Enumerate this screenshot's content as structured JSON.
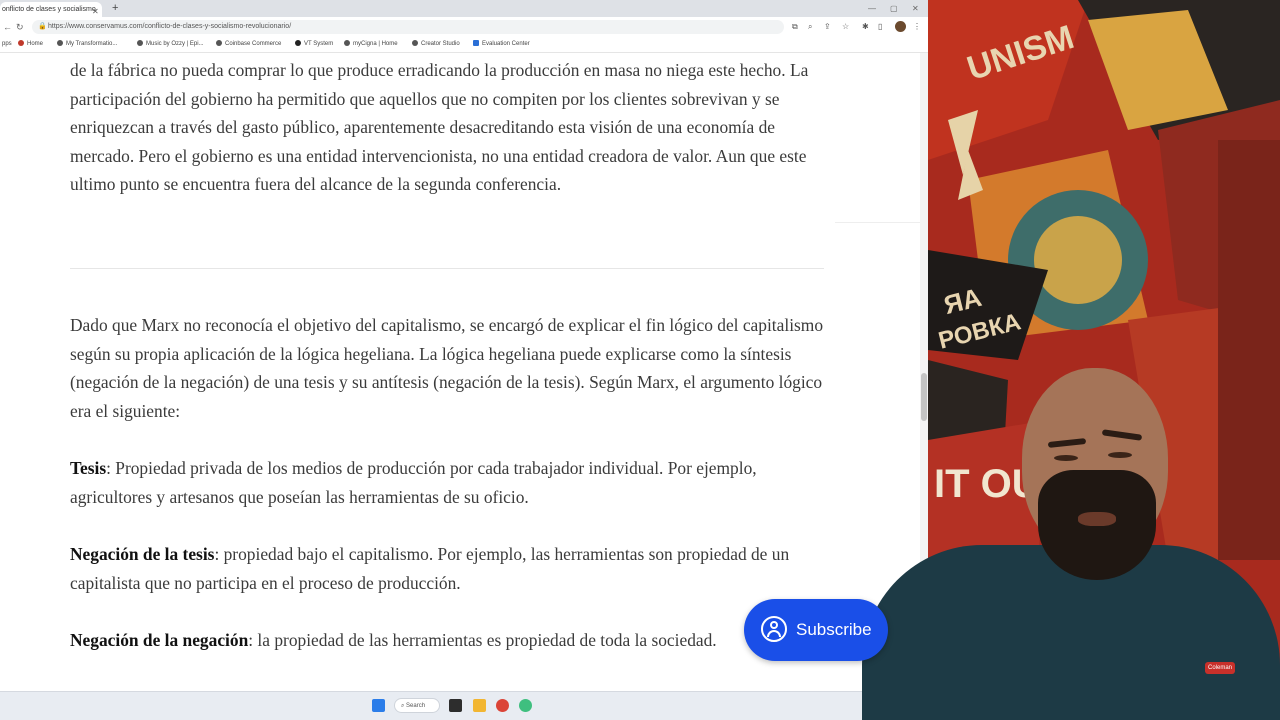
{
  "browser": {
    "tab_title": "onflicto de clases y socialismo",
    "address_url": "https://www.conservamus.com/conflicto-de-clases-y-socialismo-revolucionario/",
    "bookmarks": [
      "Home",
      "My Transformatio...",
      "Music by Ozzy | Epi...",
      "Coinbase Commerce",
      "VT System",
      "myCigna | Home",
      "Creator Studio",
      "Evaluation Center"
    ]
  },
  "article": {
    "para1": "de la fábrica no pueda comprar lo que produce erradicando la producción en masa no niega este hecho. La participación del gobierno ha permitido que aquellos que no compiten por los clientes sobrevivan y se enriquezcan a través del gasto público,  aparentemente desacreditando esta visión de una economía de mercado. Pero el gobierno es una entidad intervencionista, no una entidad creadora de valor. Aun que este ultimo punto se encuentra fuera del alcance de la segunda conferencia.",
    "para2": "Dado que Marx no reconocía el objetivo del capitalismo, se encargó de explicar el fin lógico del capitalismo según su propia aplicación de la lógica hegeliana.  La lógica hegeliana puede explicarse como la síntesis (negación de la negación) de una tesis y su antítesis (negación de la tesis).  Según Marx, el argumento lógico era el siguiente:",
    "thesis_term": "Tesis",
    "thesis_text": ": Propiedad privada de los medios de producción por cada trabajador individual.  Por ejemplo, agricultores y artesanos que poseían las herramientas de su oficio.",
    "neg_thesis_term": "Negación de la tesis",
    "neg_thesis_text": ": propiedad bajo el capitalismo. Por ejemplo, las herramientas son propiedad de un capitalista que no participa en el proceso de producción.",
    "neg_neg_term": "Negación de la negación",
    "neg_neg_text": ": la propiedad de las herramientas es propiedad de toda la sociedad."
  },
  "taskbar": {
    "search_label": "Search"
  },
  "overlay": {
    "subscribe_label": "Subscribe"
  },
  "poster": {
    "word1": "UNISM",
    "word2": "РОВКА",
    "word3": "ЯА",
    "word4": "IT OUL"
  },
  "shirt_logo": "Coleman",
  "colors": {
    "subscribe_blue": "#1a4fe8",
    "poster_red": "#b02a20",
    "shirt": "#1d3a45"
  }
}
